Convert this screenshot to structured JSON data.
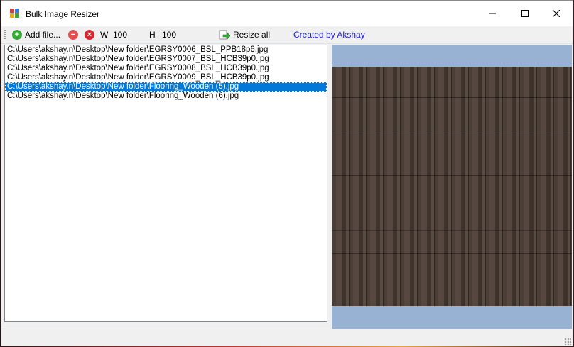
{
  "window": {
    "title": "Bulk Image Resizer",
    "controls": {
      "minimize": "—",
      "maximize": "☐",
      "close": "✕"
    }
  },
  "toolbar": {
    "add_files_label": "Add file...",
    "width_label": "W",
    "width_value": "100",
    "height_label": "H",
    "height_value": "100",
    "resize_all_label": "Resize all",
    "credit_text": "Created by Akshay",
    "icons": {
      "add": "plus-circle-icon",
      "remove": "minus-circle-icon",
      "clear": "x-circle-icon",
      "resize": "resize-arrow-icon"
    },
    "colors": {
      "add": "#3aa83a",
      "remove": "#e05050",
      "clear": "#d9272e",
      "credit": "#1a1adb"
    }
  },
  "file_list": {
    "items": [
      "C:\\Users\\akshay.n\\Desktop\\New folder\\EGRSY0006_BSL_PPB18p6.jpg",
      "C:\\Users\\akshay.n\\Desktop\\New folder\\EGRSY0007_BSL_HCB39p0.jpg",
      "C:\\Users\\akshay.n\\Desktop\\New folder\\EGRSY0008_BSL_HCB39p0.jpg",
      "C:\\Users\\akshay.n\\Desktop\\New folder\\EGRSY0009_BSL_HCB39p0.jpg",
      "C:\\Users\\akshay.n\\Desktop\\New folder\\Flooring_Wooden (5).jpg",
      "C:\\Users\\akshay.n\\Desktop\\New folder\\Flooring_Wooden (6).jpg"
    ],
    "selected_index": 4,
    "selection_color": "#0078d7"
  },
  "preview": {
    "background": "#98b2d4"
  }
}
